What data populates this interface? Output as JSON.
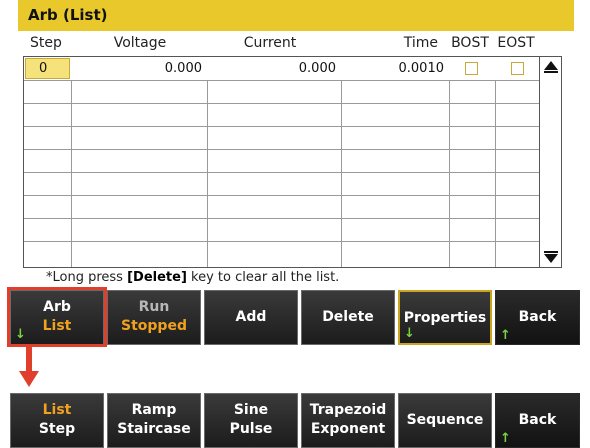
{
  "title": "Arb (List)",
  "columns": [
    "Step",
    "Voltage",
    "Current",
    "Time",
    "BOST",
    "EOST"
  ],
  "rows": [
    {
      "step": "0",
      "voltage": "0.000",
      "current": "0.000",
      "time": "0.0010",
      "bost": false,
      "eost": false
    },
    {
      "step": "",
      "voltage": "",
      "current": "",
      "time": ""
    },
    {
      "step": "",
      "voltage": "",
      "current": "",
      "time": ""
    },
    {
      "step": "",
      "voltage": "",
      "current": "",
      "time": ""
    },
    {
      "step": "",
      "voltage": "",
      "current": "",
      "time": ""
    },
    {
      "step": "",
      "voltage": "",
      "current": "",
      "time": ""
    },
    {
      "step": "",
      "voltage": "",
      "current": "",
      "time": ""
    },
    {
      "step": "",
      "voltage": "",
      "current": "",
      "time": ""
    },
    {
      "step": "",
      "voltage": "",
      "current": "",
      "time": ""
    }
  ],
  "note": {
    "prefix": "*Long press ",
    "key": "[Delete]",
    "suffix": " key to clear all the list."
  },
  "softkeys_top": [
    {
      "l1": "Arb",
      "l2": "List"
    },
    {
      "l1": "Run",
      "l2": "Stopped"
    },
    {
      "l1": "Add"
    },
    {
      "l1": "Delete"
    },
    {
      "l1": "Properties"
    },
    {
      "l1": "Back"
    }
  ],
  "softkeys_bottom": [
    {
      "l1": "List",
      "l2": "Step"
    },
    {
      "l1": "Ramp",
      "l2": "Staircase"
    },
    {
      "l1": "Sine",
      "l2": "Pulse"
    },
    {
      "l1": "Trapezoid",
      "l2": "Exponent"
    },
    {
      "l1": "Sequence"
    },
    {
      "l1": "Back"
    }
  ],
  "colors": {
    "title_bar": "#e8c82a",
    "selected_cell": "#f6e27a",
    "amber_text": "#f0a21f",
    "callout_red": "#e0402b",
    "nav_arrow_green": "#7bd342"
  },
  "icons": {
    "scroll_up": "up-triangle",
    "scroll_down": "down-triangle",
    "submenu_marker": "down-arrow",
    "parent_marker": "up-arrow"
  }
}
